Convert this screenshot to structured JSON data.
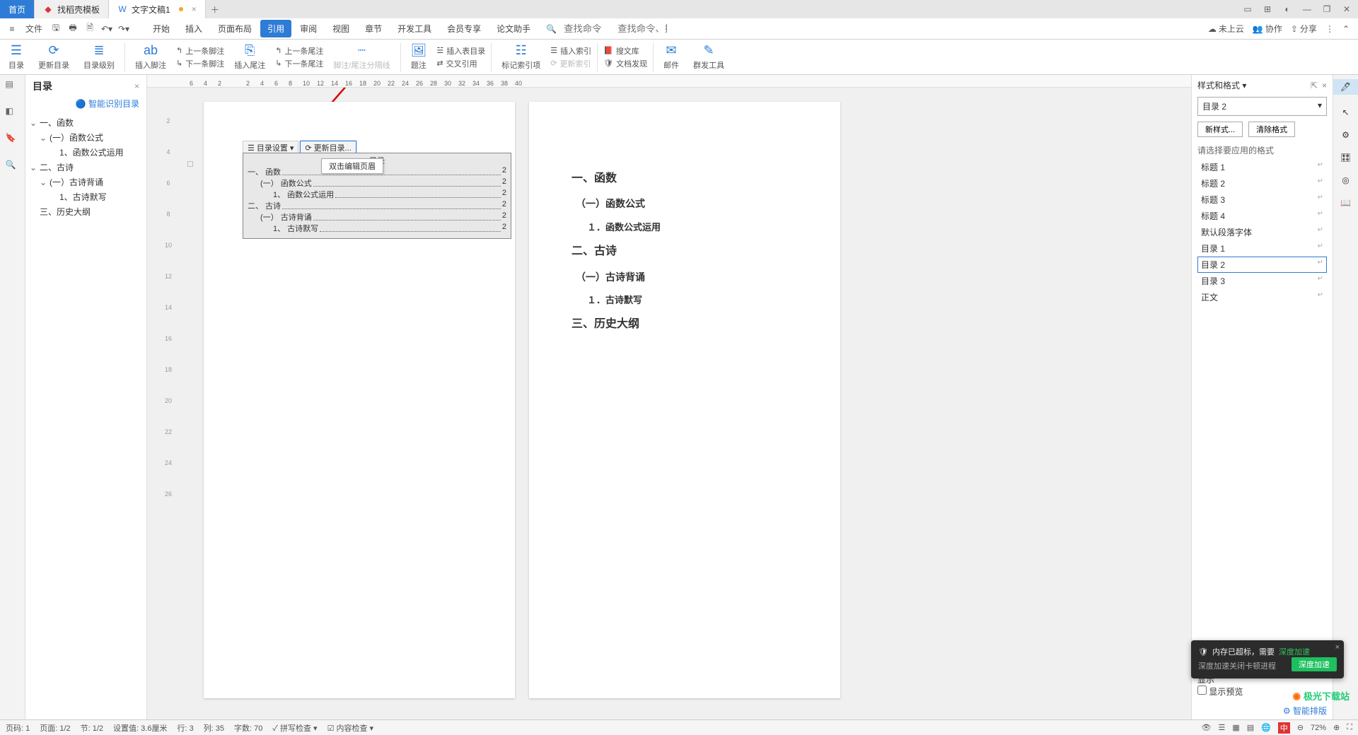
{
  "tabs": {
    "home": "首页",
    "template": "找稻壳模板",
    "doc": "文字文稿1"
  },
  "file_menu": "文件",
  "menus": [
    "开始",
    "插入",
    "页面布局",
    "引用",
    "审阅",
    "视图",
    "章节",
    "开发工具",
    "会员专享",
    "论文助手"
  ],
  "active_menu": 3,
  "search_hint": "查找命令、搜索模板",
  "cmd_hint": "查找命令",
  "cloud": "未上云",
  "collab": "协作",
  "share": "分享",
  "ribbon": {
    "mulu": "目录",
    "update": "更新目录",
    "level": "目录级别",
    "insertFoot": "插入脚注",
    "prevFoot": "上一条脚注",
    "nextFoot": "下一条脚注",
    "insertEnd": "插入尾注",
    "prevEnd": "上一条尾注",
    "nextEnd": "下一条尾注",
    "footSep": "脚注/尾注分隔线",
    "caption": "题注",
    "insertToc": "插入表目录",
    "crossRef": "交叉引用",
    "mark": "标记索引项",
    "insertIndex": "插入索引",
    "updateIndex": "更新索引",
    "lib": "搜文库",
    "discover": "文档发现",
    "mail": "邮件",
    "mass": "群发工具"
  },
  "outline": {
    "title": "目录",
    "smart": "智能识别目录",
    "items": [
      {
        "level": 1,
        "txt": "一、函数",
        "caret": true
      },
      {
        "level": 2,
        "txt": "(一）函数公式",
        "caret": true
      },
      {
        "level": 3,
        "txt": "1、函数公式运用",
        "caret": false
      },
      {
        "level": 1,
        "txt": "二、古诗",
        "caret": true
      },
      {
        "level": 2,
        "txt": "(一）古诗背诵",
        "caret": true
      },
      {
        "level": 3,
        "txt": "1、古诗默写",
        "caret": false
      },
      {
        "level": 1,
        "txt": "三、历史大纲",
        "caret": false
      }
    ]
  },
  "toc_bar": {
    "settings": "目录设置",
    "update": "更新目录...",
    "tooltip": "双击编辑页眉"
  },
  "toc": {
    "heading": "目录",
    "rows": [
      {
        "lvl": 1,
        "txt": "一、 函数",
        "pg": "2"
      },
      {
        "lvl": 2,
        "txt": "(一） 函数公式",
        "pg": "2"
      },
      {
        "lvl": 3,
        "txt": "1、 函数公式运用",
        "pg": "2"
      },
      {
        "lvl": 1,
        "txt": "二、 古诗",
        "pg": "2"
      },
      {
        "lvl": 2,
        "txt": "(一） 古诗背诵",
        "pg": "2"
      },
      {
        "lvl": 3,
        "txt": "1、 古诗默写",
        "pg": "2"
      }
    ]
  },
  "page2": [
    "一、函数",
    "（一）函数公式",
    "１．函数公式运用",
    "二、古诗",
    "（一）古诗背诵",
    "１．古诗默写",
    "三、历史大纲"
  ],
  "page2_levels": [
    1,
    2,
    3,
    1,
    2,
    3,
    1
  ],
  "styles": {
    "title": "样式和格式",
    "current": "目录 2",
    "new": "新样式...",
    "clear": "清除格式",
    "select_label": "请选择要应用的格式",
    "list": [
      "标题 1",
      "标题 2",
      "标题 3",
      "标题 4",
      "默认段落字体",
      "目录 1",
      "目录 2",
      "目录 3",
      "正文"
    ],
    "active": 6,
    "showLabel": "显示",
    "preview": "显示预览",
    "smart": "智能排版"
  },
  "ruler_ticks": [
    "6",
    "4",
    "2",
    "",
    "2",
    "4",
    "6",
    "8",
    "10",
    "12",
    "14",
    "16",
    "18",
    "20",
    "22",
    "24",
    "26",
    "28",
    "30",
    "32",
    "34",
    "36",
    "38",
    "40"
  ],
  "ruler_v": [
    "",
    "2",
    "",
    "4",
    "",
    "6",
    "",
    "8",
    "",
    "10",
    "",
    "12",
    "",
    "14",
    "",
    "16",
    "",
    "18",
    "",
    "20",
    "",
    "22",
    "",
    "24",
    "",
    "26"
  ],
  "status": {
    "page": "页码: 1",
    "pageof": "页面: 1/2",
    "sec": "节: 1/2",
    "set": "设置值: 3.6厘米",
    "line": "行: 3",
    "col": "列: 35",
    "words": "字数: 70",
    "spell": "拼写检查",
    "content": "内容检查",
    "zoom": "72%"
  },
  "toast": {
    "main": "内存已超标，需要",
    "link": "深度加速",
    "sub": "深度加速关闭卡顿进程",
    "btn": "深度加速"
  },
  "watermark": "极光下载站",
  "ime": "中"
}
